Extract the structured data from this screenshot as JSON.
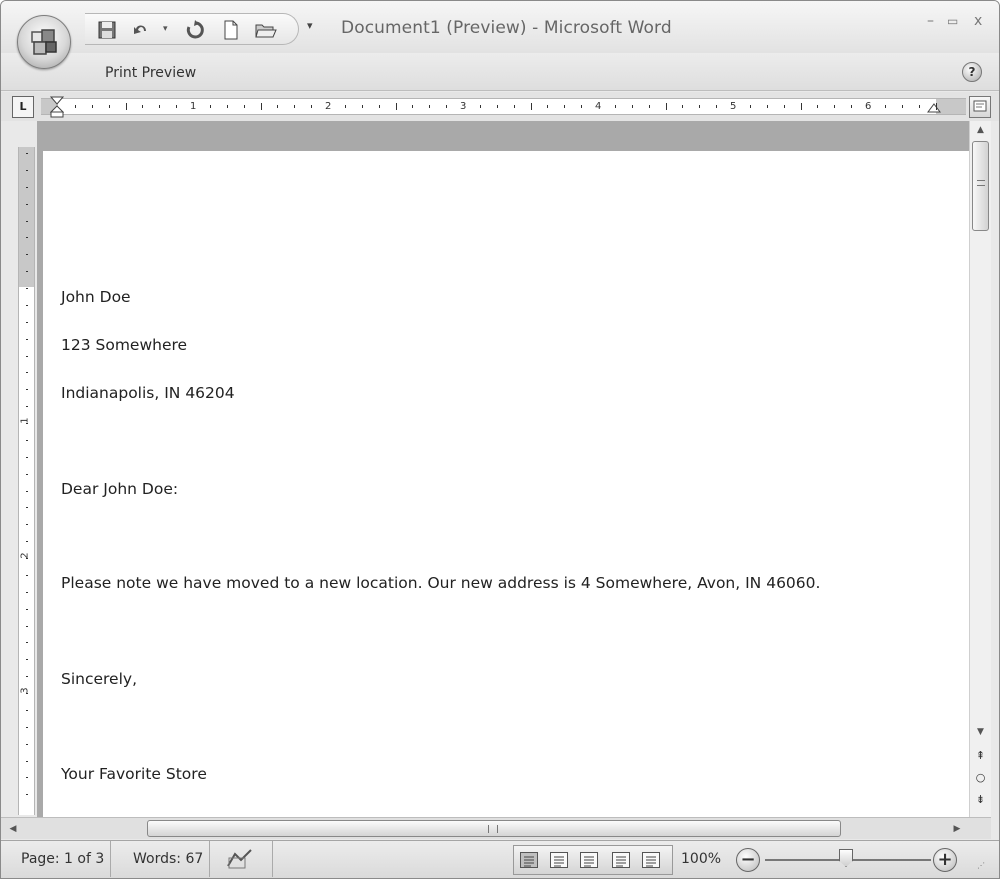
{
  "window": {
    "title": "Document1 (Preview) - Microsoft Word",
    "controls": {
      "minimize": "–",
      "maximize": "▭",
      "close": "x"
    }
  },
  "quick_access_toolbar": {
    "icons": [
      "save-icon",
      "undo-icon",
      "redo-icon",
      "new-document-icon",
      "open-folder-icon"
    ],
    "customize": "▾"
  },
  "ribbon": {
    "tab_label": "Print Preview",
    "help": "?"
  },
  "ruler": {
    "tab_selector": "L",
    "horizontal_numbers": [
      "1",
      "2",
      "3",
      "4",
      "5",
      "6"
    ],
    "vertical_numbers": [
      "1",
      "2",
      "3"
    ]
  },
  "document": {
    "lines": [
      "John Doe",
      "123 Somewhere",
      "Indianapolis, IN 46204",
      "Dear John Doe:",
      "Please note we have moved to a new location. Our new address is 4 Somewhere, Avon, IN 46060.",
      "Sincerely,",
      "Your Favorite Store"
    ]
  },
  "statusbar": {
    "page": "Page: 1 of 3",
    "words": "Words: 67",
    "zoom": "100%",
    "zoom_out": "−",
    "zoom_in": "+"
  }
}
